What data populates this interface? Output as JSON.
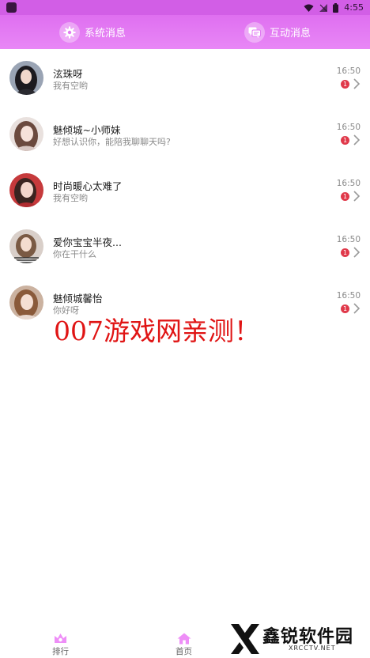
{
  "status_bar": {
    "time": "4:55"
  },
  "tabs": [
    {
      "label": "系统消息",
      "icon": "gear-icon"
    },
    {
      "label": "互动消息",
      "icon": "chat-bubbles-icon"
    }
  ],
  "messages": [
    {
      "name": "泫珠呀",
      "preview": "我有空哟",
      "time": "16:50",
      "badge": "1"
    },
    {
      "name": "魅倾城~小师妹",
      "preview": "好想认识你，能陪我聊聊天吗?",
      "time": "16:50",
      "badge": "1"
    },
    {
      "name": "时尚暖心太难了",
      "preview": "我有空哟",
      "time": "16:50",
      "badge": "1"
    },
    {
      "name": " 爱你宝宝半夜...",
      "preview": "你在干什么",
      "time": "16:50",
      "badge": "1"
    },
    {
      "name": "魅倾城馨怡",
      "preview": "你好呀",
      "time": "16:50",
      "badge": "1"
    }
  ],
  "watermark": "007游戏网亲测！",
  "bottom_nav": [
    {
      "label": "排行",
      "icon": "flower-icon"
    },
    {
      "label": "首页",
      "icon": "home-icon"
    }
  ],
  "site_logo": {
    "name": "鑫锐软件园",
    "sub": "XRCCTV.NET"
  },
  "colors": {
    "header": "#e070f2",
    "badge": "#e0394a",
    "watermark": "#e01414"
  }
}
